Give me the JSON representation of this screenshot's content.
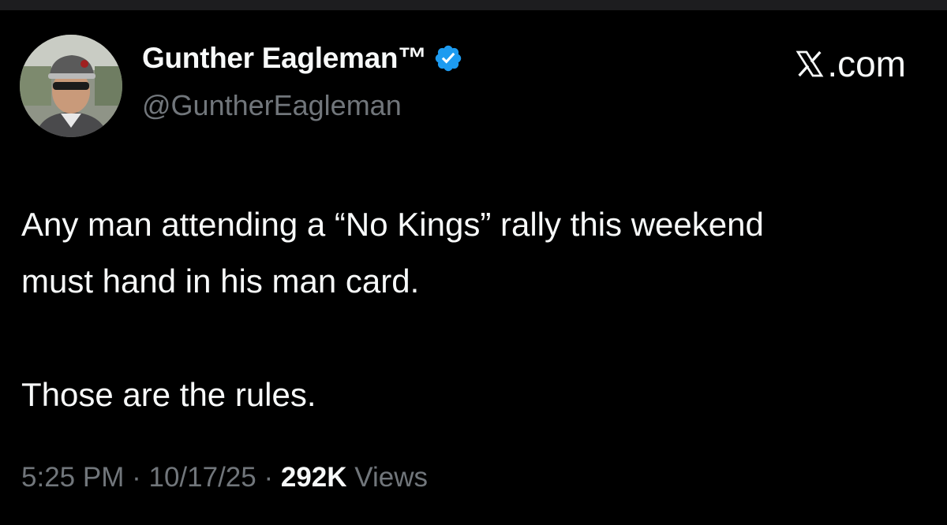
{
  "author": {
    "display_name": "Gunther Eagleman™",
    "handle": "@GuntherEagleman",
    "verified_color": "#1d9bf0"
  },
  "source": {
    "label": ".com",
    "icon": "x-logo-icon"
  },
  "tweet": {
    "line_1": "Any man attending a “No Kings” rally this weekend",
    "line_2": "must hand in his man card.",
    "line_3": "Those are the rules."
  },
  "meta": {
    "time": "5:25 PM",
    "separator": "·",
    "date": "10/17/25",
    "views_count": "292K",
    "views_label": "Views"
  },
  "colors": {
    "background": "#000000",
    "primary_text": "#f7f9f9",
    "secondary_text": "#71767b"
  }
}
